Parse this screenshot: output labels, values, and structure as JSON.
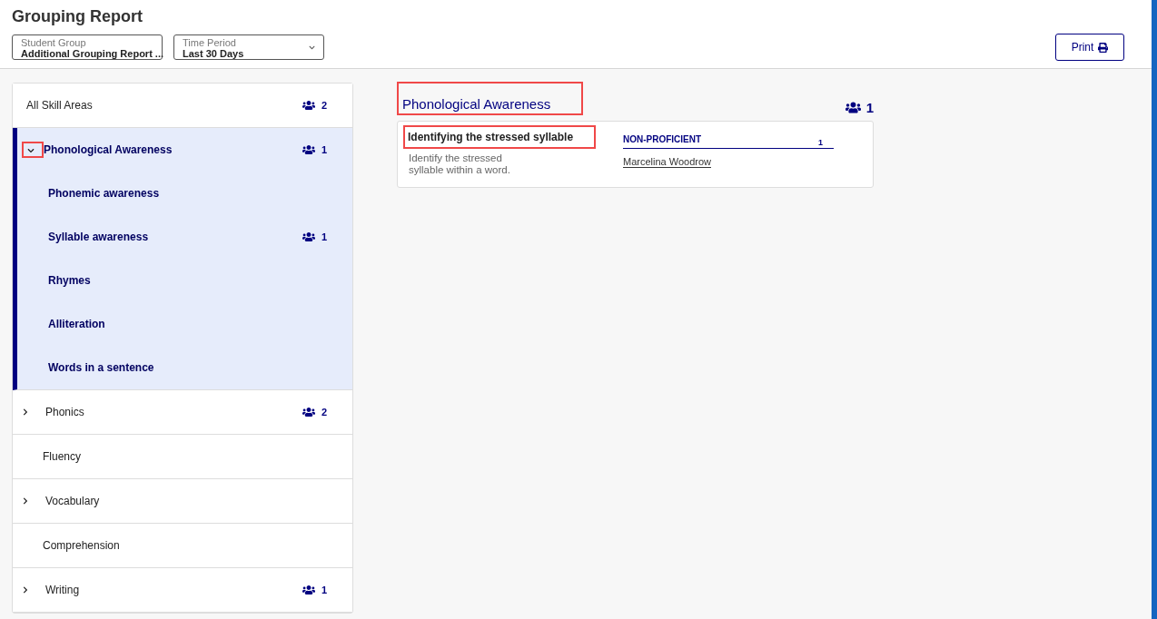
{
  "title": "Grouping Report",
  "filters": [
    {
      "label": "Student Group",
      "value": "Additional Grouping Report ..."
    },
    {
      "label": "Time Period",
      "value": "Last 30 Days"
    }
  ],
  "print_button": {
    "label": "Print"
  },
  "sidebar": {
    "items": [
      {
        "label": "All Skill Areas",
        "kind": "all",
        "count": "2",
        "selected": false
      },
      {
        "label": "Phonological Awareness",
        "kind": "group",
        "expanded": true,
        "selected": true,
        "count": "1",
        "children": [
          {
            "label": "Phonemic awareness"
          },
          {
            "label": "Syllable awareness",
            "count": "1"
          },
          {
            "label": "Rhymes"
          },
          {
            "label": "Alliteration"
          },
          {
            "label": "Words in a sentence"
          }
        ]
      },
      {
        "label": "Phonics",
        "kind": "group",
        "expanded": false,
        "selected": false,
        "count": "2"
      },
      {
        "label": "Fluency",
        "kind": "leaf",
        "selected": false
      },
      {
        "label": "Vocabulary",
        "kind": "group",
        "expanded": false,
        "selected": false
      },
      {
        "label": "Comprehension",
        "kind": "leaf",
        "selected": false
      },
      {
        "label": "Writing",
        "kind": "group",
        "expanded": false,
        "selected": false,
        "count": "1"
      }
    ]
  },
  "main": {
    "heading": "Phonological Awareness",
    "count": "1",
    "skills": [
      {
        "title": "Identifying the stressed syllable",
        "description": "Identify the stressed syllable within a word.",
        "level": "NON-PROFICIENT",
        "level_count": "1",
        "students": [
          "Marcelina Woodrow"
        ]
      }
    ]
  }
}
